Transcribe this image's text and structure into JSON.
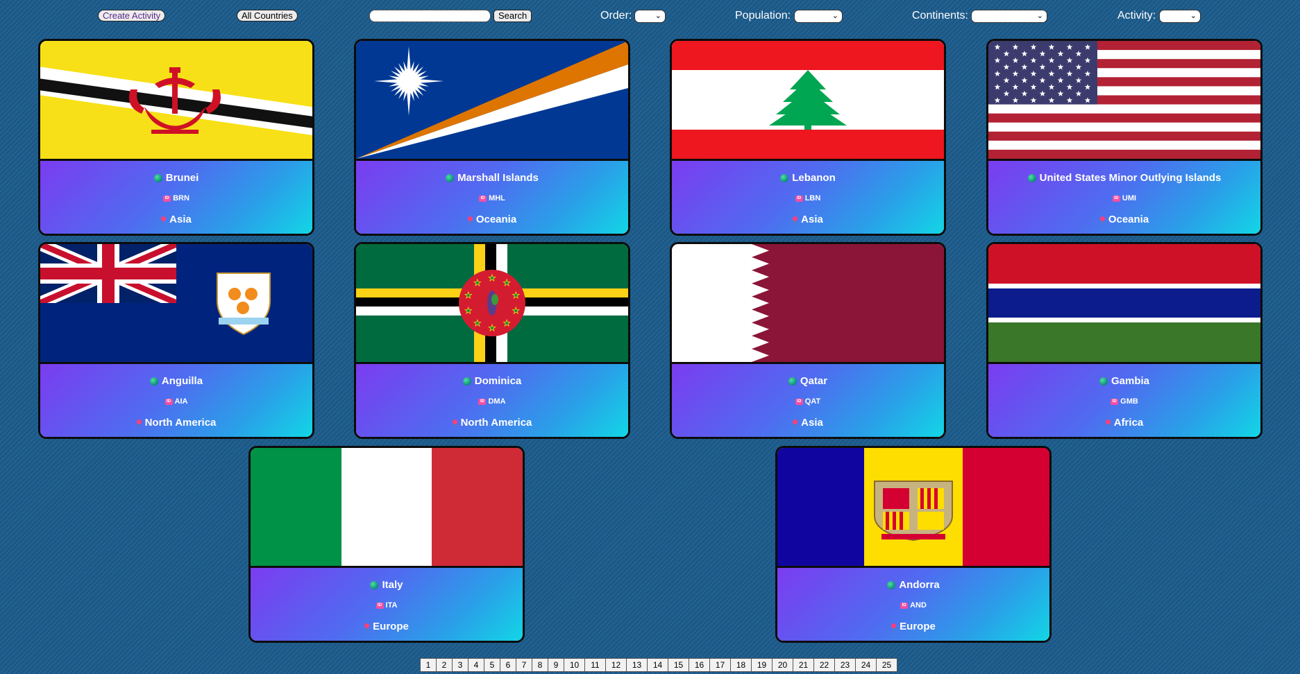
{
  "filters": {
    "create_activity": "Create Activity",
    "all_countries": "All Countries",
    "search_value": "",
    "search_button": "Search",
    "order_label": "Order:",
    "population_label": "Population:",
    "continents_label": "Continents:",
    "activity_label": "Activity:"
  },
  "countries": [
    {
      "name": "Brunei",
      "code": "BRN",
      "continent": "Asia",
      "flag": "brunei"
    },
    {
      "name": "Marshall Islands",
      "code": "MHL",
      "continent": "Oceania",
      "flag": "marshall-islands"
    },
    {
      "name": "Lebanon",
      "code": "LBN",
      "continent": "Asia",
      "flag": "lebanon"
    },
    {
      "name": "United States Minor Outlying Islands",
      "code": "UMI",
      "continent": "Oceania",
      "flag": "united-states"
    },
    {
      "name": "Anguilla",
      "code": "AIA",
      "continent": "North America",
      "flag": "anguilla"
    },
    {
      "name": "Dominica",
      "code": "DMA",
      "continent": "North America",
      "flag": "dominica"
    },
    {
      "name": "Qatar",
      "code": "QAT",
      "continent": "Asia",
      "flag": "qatar"
    },
    {
      "name": "Gambia",
      "code": "GMB",
      "continent": "Africa",
      "flag": "gambia"
    },
    {
      "name": "Italy",
      "code": "ITA",
      "continent": "Europe",
      "flag": "italy"
    },
    {
      "name": "Andorra",
      "code": "AND",
      "continent": "Europe",
      "flag": "andorra"
    }
  ],
  "pagination": [
    "1",
    "2",
    "3",
    "4",
    "5",
    "6",
    "7",
    "8",
    "9",
    "10",
    "11",
    "12",
    "13",
    "14",
    "15",
    "16",
    "17",
    "18",
    "19",
    "20",
    "21",
    "22",
    "23",
    "24",
    "25"
  ],
  "icons": {
    "country": "globe-icon",
    "code": "id-badge-icon",
    "continent": "pin-icon"
  }
}
